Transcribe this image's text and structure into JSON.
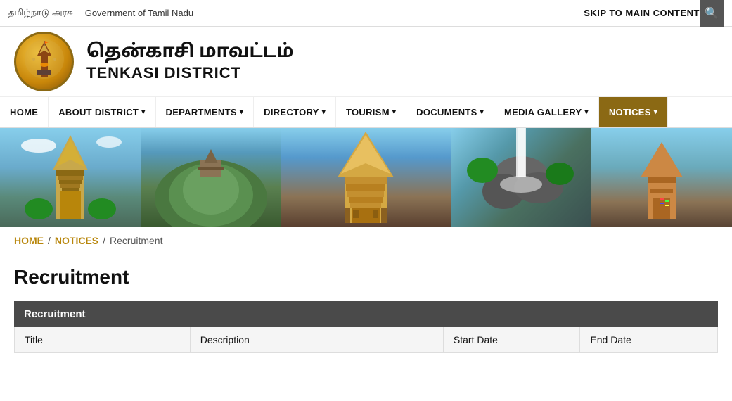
{
  "topbar": {
    "tamil_govt": "தமிழ்நாடு அரசு",
    "english_govt": "Government of Tamil Nadu",
    "skip_label": "SKIP TO MAIN CONTENT"
  },
  "header": {
    "logo_icon": "🏛️",
    "tamil_name": "தென்காசி மாவட்டம்",
    "english_name": "TENKASI DISTRICT"
  },
  "nav": {
    "items": [
      {
        "label": "HOME",
        "has_dropdown": false
      },
      {
        "label": "ABOUT DISTRICT",
        "has_dropdown": true
      },
      {
        "label": "DEPARTMENTS",
        "has_dropdown": true
      },
      {
        "label": "DIRECTORY",
        "has_dropdown": true
      },
      {
        "label": "TOURISM",
        "has_dropdown": true
      },
      {
        "label": "DOCUMENTS",
        "has_dropdown": true
      },
      {
        "label": "MEDIA GALLERY",
        "has_dropdown": true
      },
      {
        "label": "NOTICES",
        "has_dropdown": true,
        "active": true
      }
    ]
  },
  "breadcrumb": {
    "home": "HOME",
    "notices": "NOTICES",
    "current": "Recruitment"
  },
  "page": {
    "title": "Recruitment"
  },
  "table": {
    "section_header": "Recruitment",
    "columns": [
      {
        "label": "Title"
      },
      {
        "label": "Description"
      },
      {
        "label": "Start Date"
      },
      {
        "label": "End Date"
      }
    ]
  }
}
